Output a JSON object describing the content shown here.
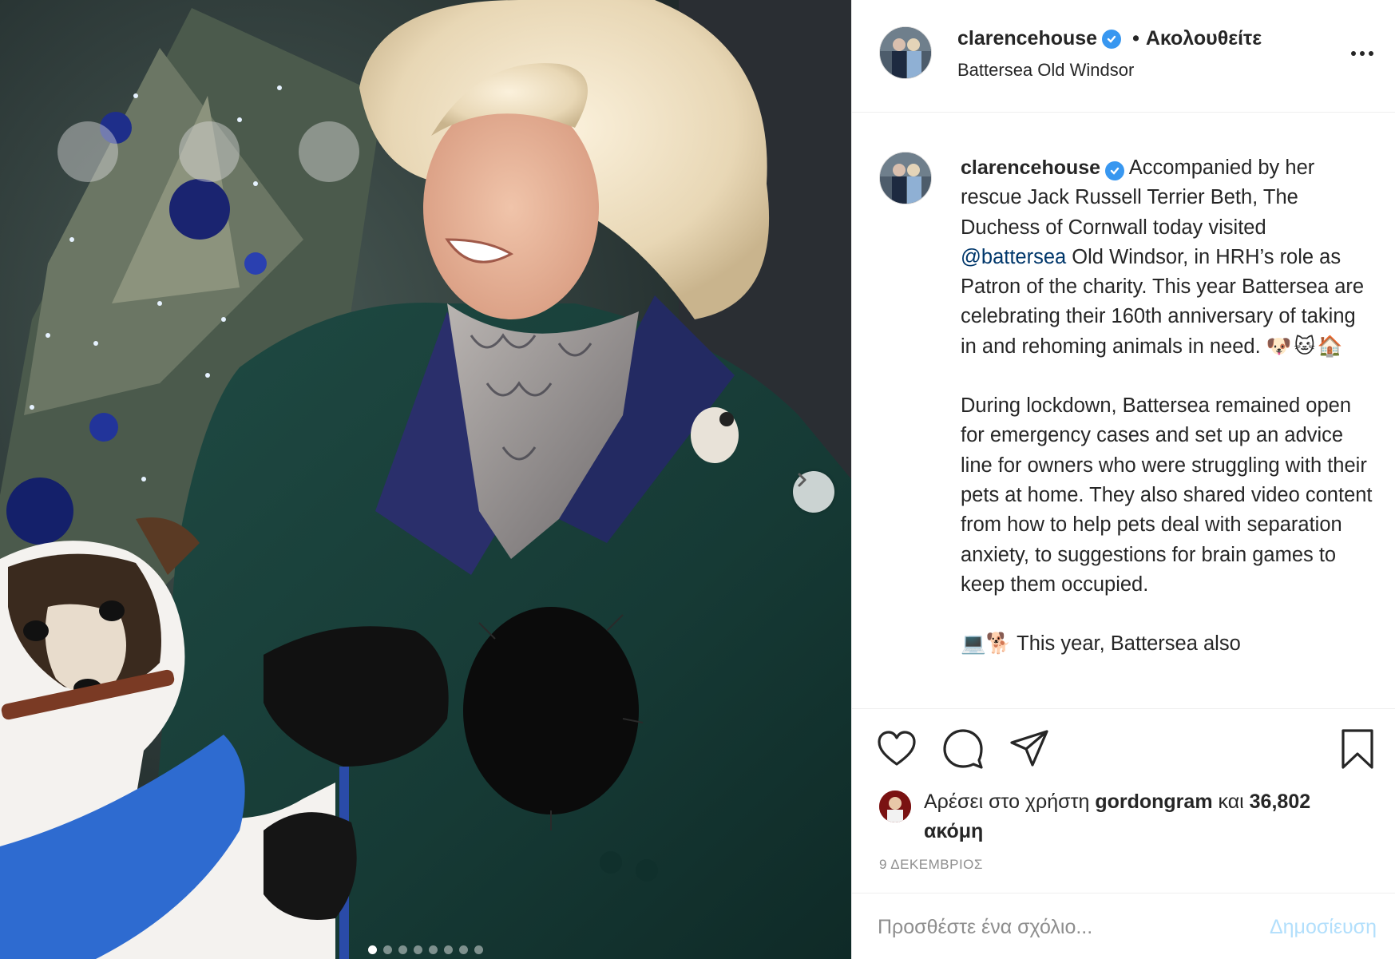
{
  "post": {
    "username": "clarencehouse",
    "verified": true,
    "follow_separator": "•",
    "follow_label": "Ακολουθείτε",
    "location": "Battersea Old Windsor",
    "caption_intro": "Accompanied by her rescue Jack Russell Terrier Beth, The Duchess of Cornwall today visited ",
    "caption_mention": "@battersea",
    "caption_after_mention": " Old Windsor, in HRH’s role as Patron of the charity. This year Battersea are celebrating their 160th anniversary of taking in and rehoming animals in need. ",
    "caption_emojis": [
      "🐶",
      "🐱",
      "🏠"
    ],
    "caption_paragraph2": "During lockdown, Battersea remained open for emergency cases and set up an advice line for owners who were struggling with their pets at home. They also shared video content from how to help pets deal with separation anxiety, to suggestions for brain games to keep them occupied.",
    "caption_paragraph3": "💻🐕 This year, Battersea also"
  },
  "media": {
    "carousel_total": 8,
    "carousel_active": 0,
    "next_icon": "chevron-right-icon"
  },
  "actions": {
    "like_icon": "heart-icon",
    "comment_icon": "comment-icon",
    "share_icon": "paper-plane-icon",
    "save_icon": "bookmark-icon"
  },
  "likes": {
    "prefix": "Αρέσει στο χρήστη",
    "user": "gordongram",
    "conjunction": "και",
    "count": "36,802 ακόμη"
  },
  "date": "9 ΔΕΚΕΜΒΡΙΟΣ",
  "comment": {
    "placeholder": "Προσθέστε ένα σχόλιο...",
    "post_label": "Δημοσίευση"
  },
  "colors": {
    "verified_badge": "#3897f0",
    "mention": "#00376b",
    "post_button_disabled": "#b2dffc"
  }
}
